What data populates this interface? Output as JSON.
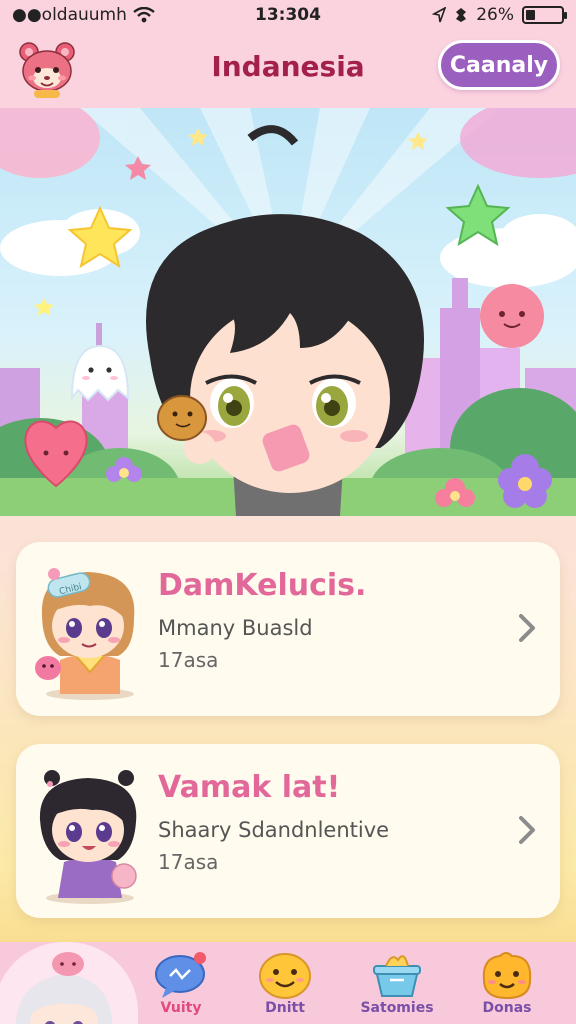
{
  "status_bar": {
    "carrier": "●●oldauumh",
    "time": "13:304",
    "battery_text": "26%",
    "battery_level": 0.26
  },
  "header": {
    "title": "Indanesia",
    "button_label": "Caanaly"
  },
  "cards": [
    {
      "title": "DamKelucis.",
      "subtitle": "Mmany Buasld",
      "meta": "17asa",
      "avatar_badge": "Chibi"
    },
    {
      "title": "Vamak lat!",
      "subtitle": "Shaary Sdandnlentive",
      "meta": "17asa"
    }
  ],
  "tabs": [
    {
      "label": "Vuity",
      "icon": "chat-bubble-icon",
      "active": true
    },
    {
      "label": "Dnitt",
      "icon": "smiley-face-icon"
    },
    {
      "label": "Satomies",
      "icon": "basket-icon"
    },
    {
      "label": "Donas",
      "icon": "blob-face-icon"
    }
  ],
  "colors": {
    "accent": "#9b5fc0",
    "title": "#a3204d",
    "card_title": "#e2689a",
    "tab_bar": "#f8c9da"
  }
}
